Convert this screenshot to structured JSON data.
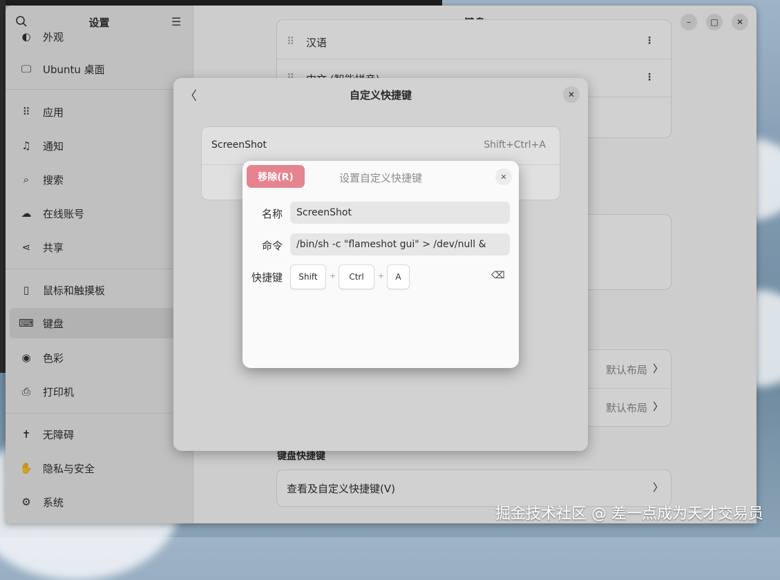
{
  "sidebar": {
    "title": "设置",
    "items": [
      {
        "label": "Ubuntu 桌面"
      },
      {
        "label": "应用"
      },
      {
        "label": "通知"
      },
      {
        "label": "搜索"
      },
      {
        "label": "在线账号"
      },
      {
        "label": "共享"
      },
      {
        "label": "鼠标和触摸板"
      },
      {
        "label": "键盘"
      },
      {
        "label": "色彩"
      },
      {
        "label": "打印机"
      },
      {
        "label": "无障碍"
      },
      {
        "label": "隐私与安全"
      },
      {
        "label": "系统"
      }
    ],
    "partial_top": "外观"
  },
  "main": {
    "title": "键盘",
    "input_sources": [
      {
        "label": "汉语"
      },
      {
        "label": "中文 (智能拼音)"
      }
    ],
    "layout_value": "默认布局",
    "shortcuts_heading": "键盘快捷键",
    "view_shortcuts_label": "查看及自定义快捷键(V)"
  },
  "custom_shortcuts_dialog": {
    "title": "自定义快捷键",
    "entry_name": "ScreenShot",
    "entry_accel": "Shift+Ctrl+A"
  },
  "edit_dialog": {
    "title": "设置自定义快捷键",
    "remove_label": "移除(R)",
    "name_label": "名称",
    "name_value": "ScreenShot",
    "command_label": "命令",
    "command_value": "/bin/sh -c \"flameshot gui\" > /dev/null &",
    "shortcut_label": "快捷键",
    "keys": [
      "Shift",
      "Ctrl",
      "A"
    ],
    "plus": "+"
  },
  "watermark": "掘金技术社区 @ 差一点成为天才交易员"
}
